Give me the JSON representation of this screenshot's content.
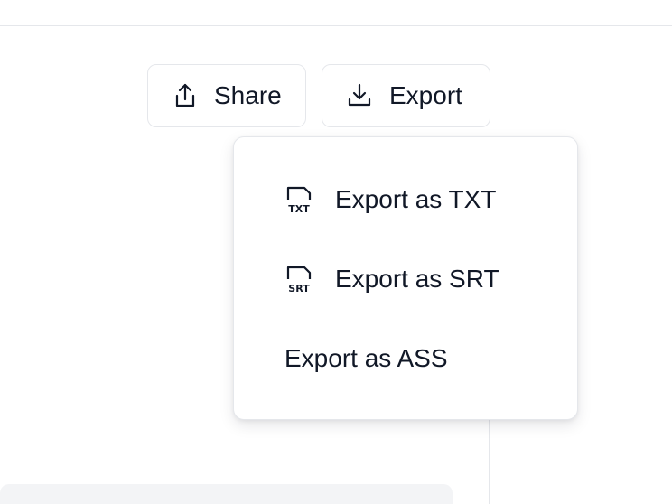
{
  "toolbar": {
    "share": {
      "label": "Share",
      "icon": "share-upload-icon"
    },
    "export": {
      "label": "Export",
      "icon": "download-icon"
    }
  },
  "export_menu": {
    "items": [
      {
        "label": "Export as TXT",
        "icon": "txt-file-icon",
        "icon_text": "TXT"
      },
      {
        "label": "Export as SRT",
        "icon": "srt-file-icon",
        "icon_text": "SRT"
      },
      {
        "label": "Export as ASS",
        "icon": ""
      }
    ]
  },
  "colors": {
    "text": "#111827",
    "border": "#e5e7eb",
    "panel": "#f3f4f6",
    "background": "#ffffff"
  }
}
